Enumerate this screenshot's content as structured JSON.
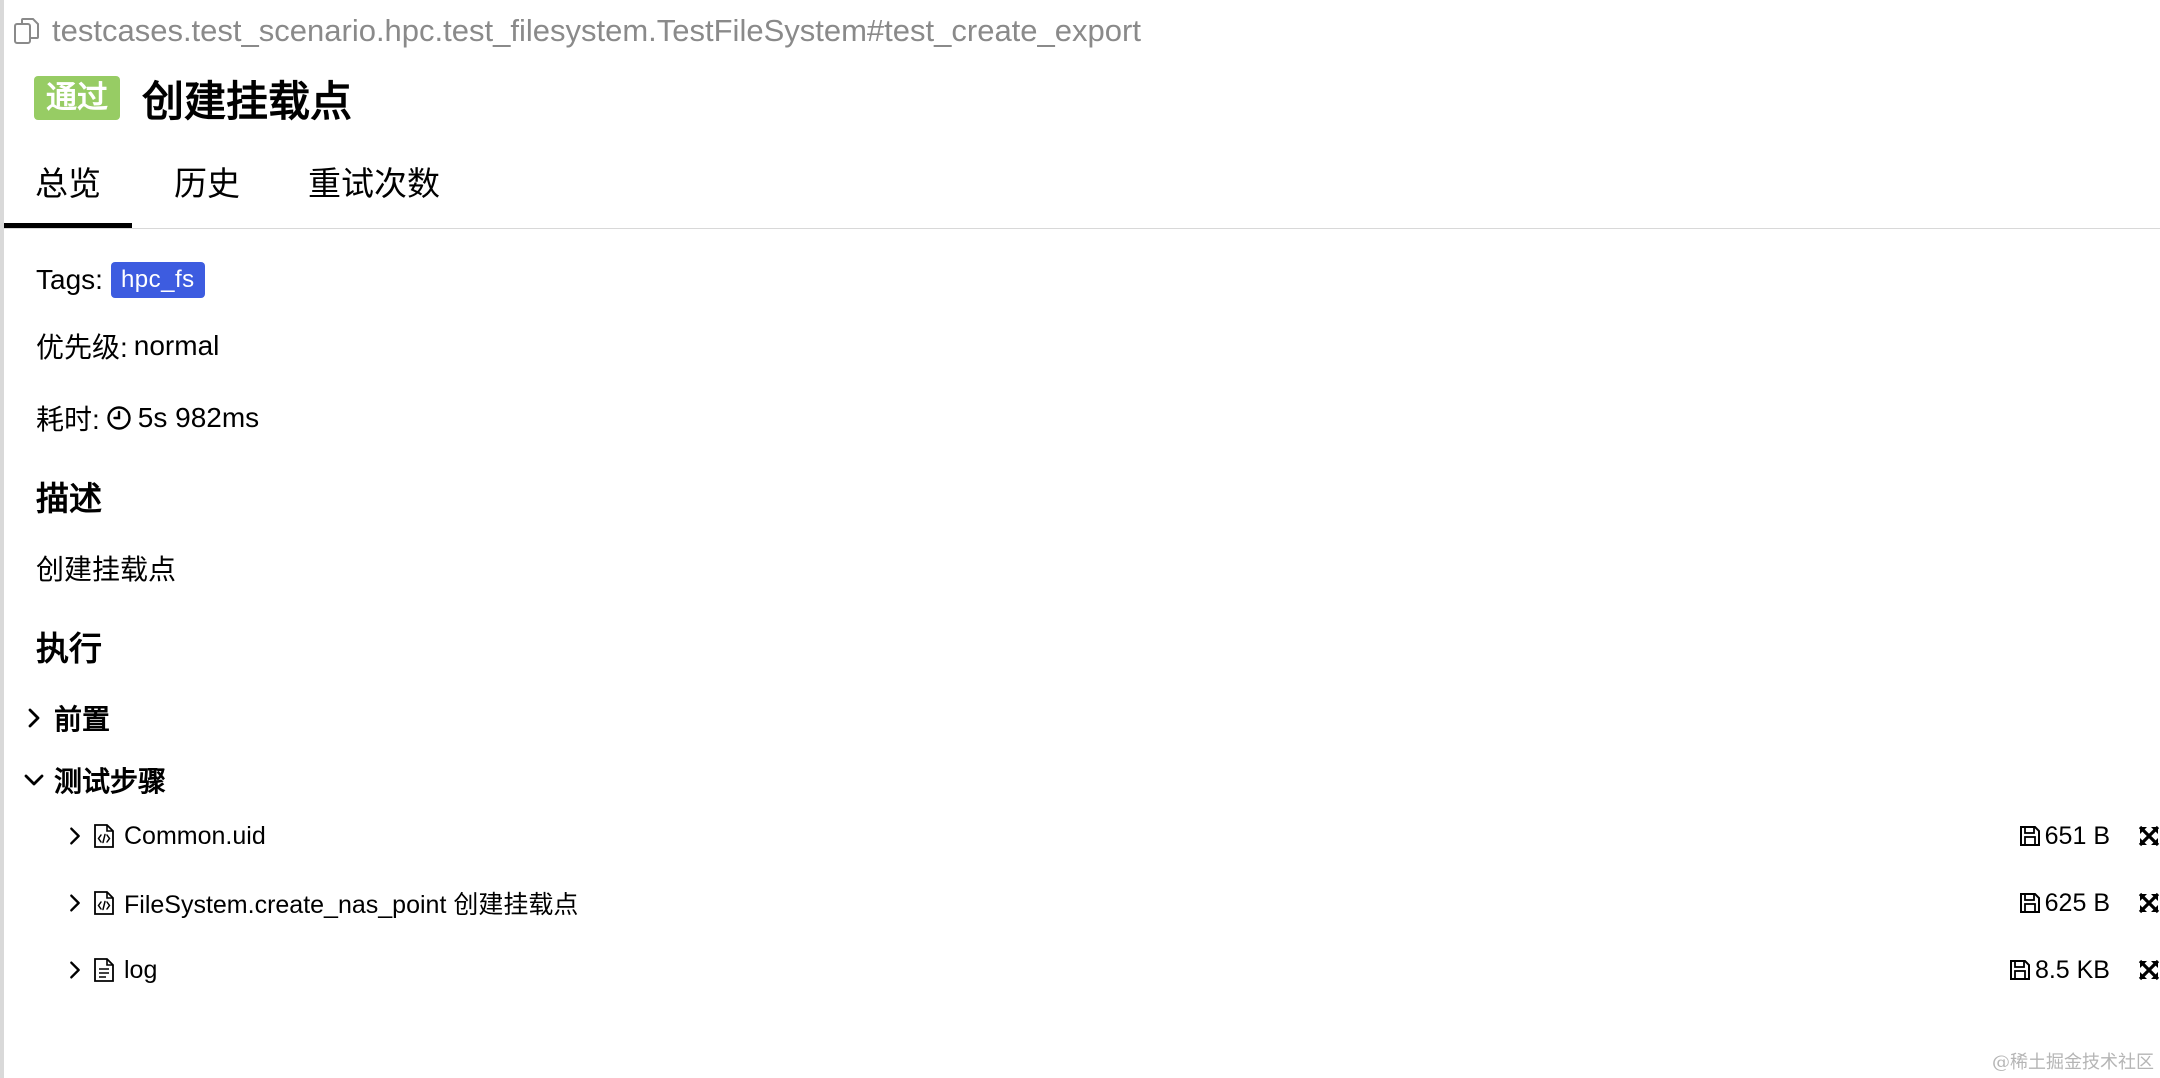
{
  "header": {
    "path": "testcases.test_scenario.hpc.test_filesystem.TestFileSystem#test_create_export",
    "status": "通过",
    "title": "创建挂载点",
    "status_color": "#97cc64"
  },
  "tabs": [
    {
      "label": "总览",
      "active": true
    },
    {
      "label": "历史",
      "active": false
    },
    {
      "label": "重试次数",
      "active": false
    }
  ],
  "overview": {
    "tags_label": "Tags:",
    "tag": "hpc_fs",
    "tag_color": "#3d5ce0",
    "priority_label": "优先级:",
    "priority": "normal",
    "duration_label": "耗时:",
    "duration": "5s 982ms",
    "description_heading": "描述",
    "description": "创建挂载点",
    "execution_heading": "执行"
  },
  "sections": {
    "setup": {
      "label": "前置",
      "expanded": false
    },
    "steps": {
      "label": "测试步骤",
      "expanded": true
    }
  },
  "steps": [
    {
      "name": "Common.uid",
      "icon": "code-file-icon",
      "size": "651 B"
    },
    {
      "name": "FileSystem.create_nas_point 创建挂载点",
      "icon": "code-file-icon",
      "size": "625 B"
    },
    {
      "name": "log",
      "icon": "text-file-icon",
      "size": "8.5 KB"
    }
  ],
  "watermark": "@稀土掘金技术社区"
}
